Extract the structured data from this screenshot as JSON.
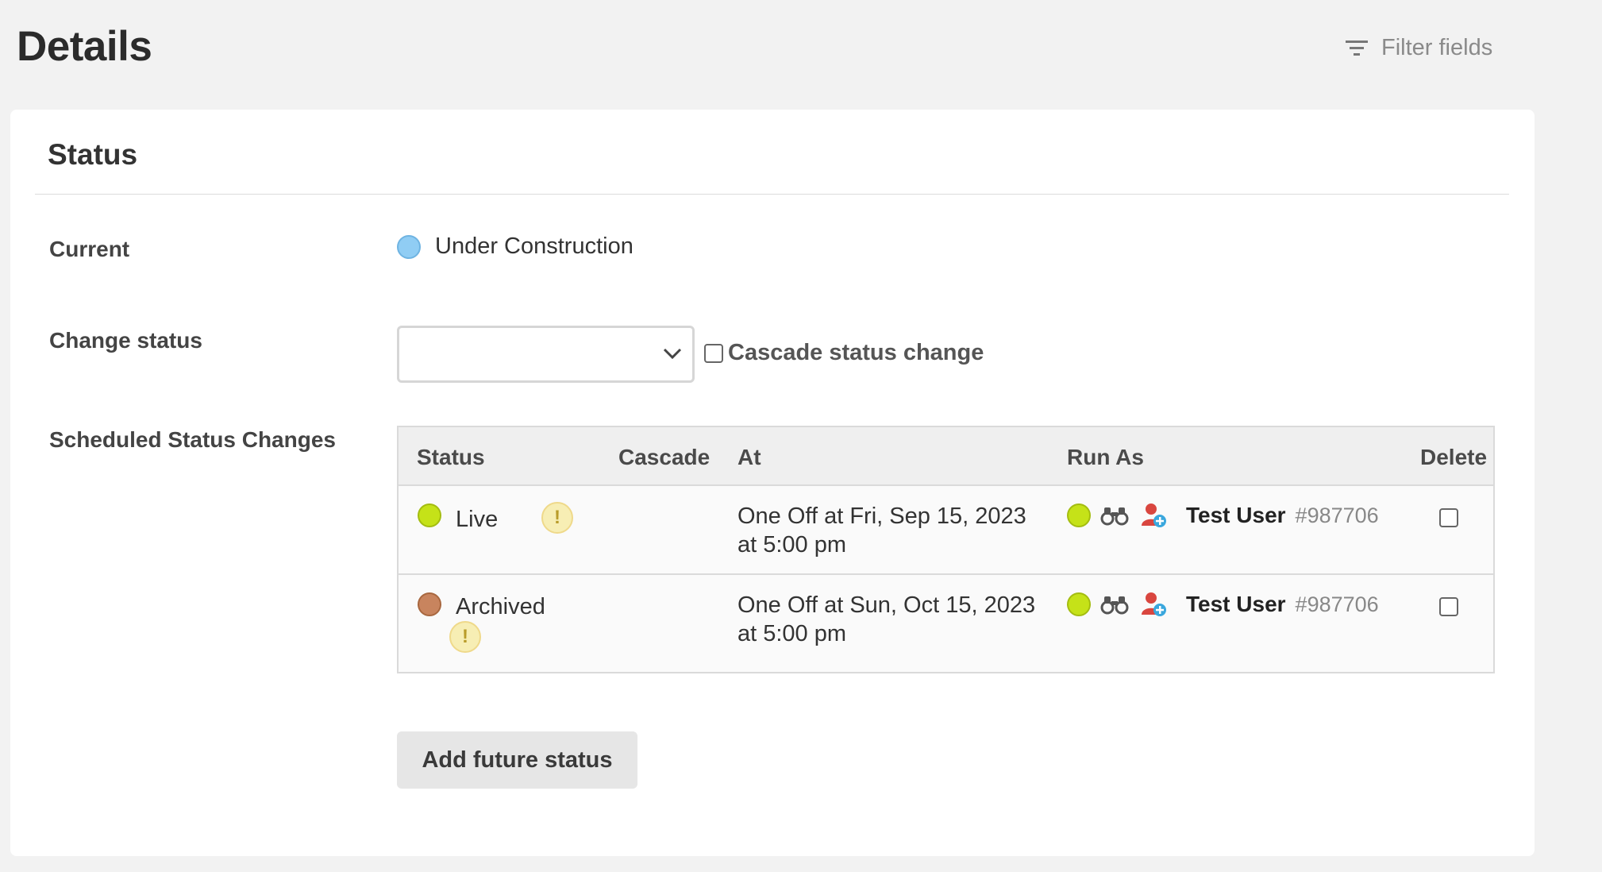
{
  "header": {
    "title": "Details",
    "filter_label": "Filter fields",
    "filter_icon": "filter-icon"
  },
  "panel": {
    "title": "Status",
    "current_label": "Current",
    "current_value": "Under Construction",
    "current_color": "#90cdf4",
    "change_label": "Change status",
    "change_selected": "",
    "cascade_label": "Cascade status change",
    "cascade_checked": false,
    "scheduled_label": "Scheduled Status Changes",
    "table": {
      "headers": [
        "Status",
        "Cascade",
        "At",
        "Run As",
        "Delete"
      ],
      "rows": [
        {
          "status": "Live",
          "status_color": "#c5e218",
          "warning": "!",
          "at_line1": "One Off at Fri, Sep 15, 2023",
          "at_line2": "at 5:00 pm",
          "run_as_status_color": "#c5e218",
          "user_name": "Test User",
          "user_id": "#987706",
          "delete_checked": false
        },
        {
          "status": "Archived",
          "status_color": "#c8845e",
          "warning": "!",
          "at_line1": "One Off at Sun, Oct 15, 2023",
          "at_line2": "at 5:00 pm",
          "run_as_status_color": "#c5e218",
          "user_name": "Test User",
          "user_id": "#987706",
          "delete_checked": false
        }
      ]
    },
    "add_button": "Add future status"
  }
}
